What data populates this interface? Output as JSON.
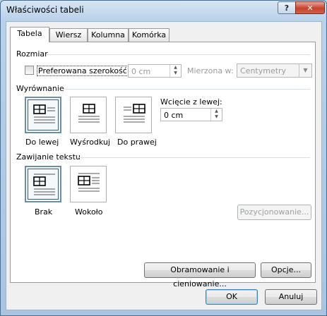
{
  "window": {
    "title": "Właściwości tabeli",
    "help_label": "?",
    "close_label": "✕"
  },
  "tabs": [
    {
      "label": "Tabela",
      "active": true
    },
    {
      "label": "Wiersz",
      "active": false
    },
    {
      "label": "Kolumna",
      "active": false
    },
    {
      "label": "Komórka",
      "active": false
    }
  ],
  "size": {
    "section_label": "Rozmiar",
    "preferred_width_label": "Preferowana szerokość:",
    "preferred_width_checked": false,
    "preferred_width_value": "0 cm",
    "measure_label": "Mierzona w:",
    "measure_value": "Centymetry"
  },
  "alignment": {
    "section_label": "Wyrównanie",
    "options": [
      {
        "label": "Do lewej",
        "selected": true,
        "icon": "align-left-icon"
      },
      {
        "label": "Wyśrodkuj",
        "selected": false,
        "icon": "align-center-icon"
      },
      {
        "label": "Do prawej",
        "selected": false,
        "icon": "align-right-icon"
      }
    ],
    "indent_label": "Wcięcie z lewej:",
    "indent_value": "0 cm"
  },
  "wrapping": {
    "section_label": "Zawijanie tekstu",
    "options": [
      {
        "label": "Brak",
        "selected": true,
        "icon": "wrap-none-icon"
      },
      {
        "label": "Wokoło",
        "selected": false,
        "icon": "wrap-around-icon"
      }
    ],
    "positioning_label": "Pozycjonowanie..."
  },
  "buttons": {
    "borders_label": "Obramowanie i cieniowanie...",
    "options_label": "Opcje...",
    "ok_label": "OK",
    "cancel_label": "Anuluj"
  }
}
